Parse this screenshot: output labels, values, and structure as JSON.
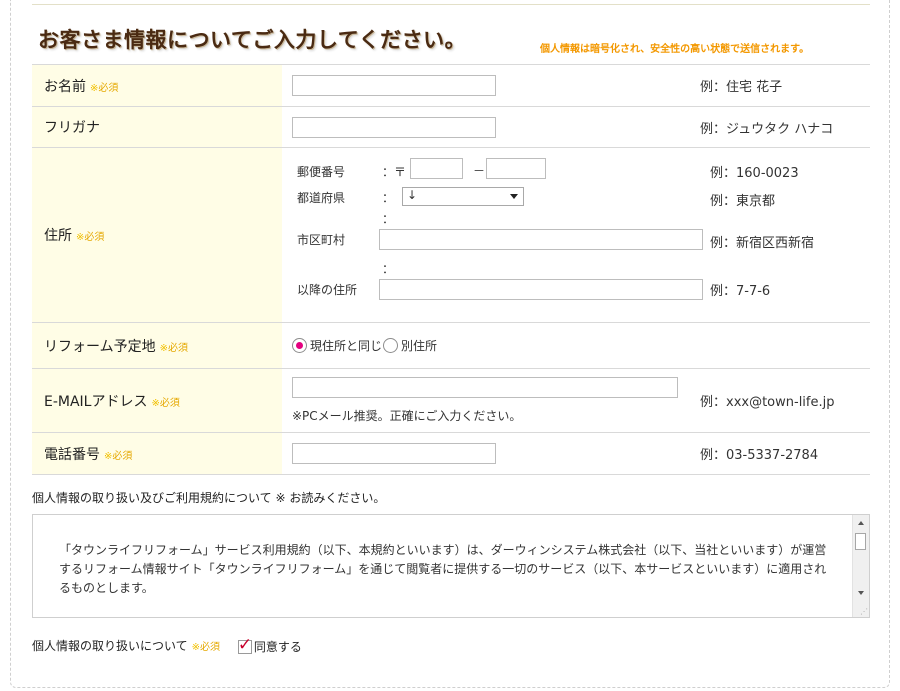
{
  "header": {
    "title": "お客さま情報についてご入力してください。",
    "notice": "個人情報は暗号化され、安全性の高い状態で送信されます。"
  },
  "required_mark": "※",
  "required_text": "必須",
  "form": {
    "name": {
      "label": "お名前",
      "value": "",
      "example": "例：住宅 花子"
    },
    "kana": {
      "label": "フリガナ",
      "value": "",
      "example": "例：ジュウタク ハナコ"
    },
    "address": {
      "label": "住所",
      "zip": {
        "label": "郵便番号",
        "prefix": "：〒",
        "dash": "－",
        "example": "例：160-0023"
      },
      "pref": {
        "label": "都道府県",
        "colon": "：",
        "selected": "↓",
        "example": "例：東京都"
      },
      "city": {
        "label": "市区町村",
        "colon": "：",
        "example": "例：新宿区西新宿"
      },
      "rest": {
        "label": "以降の住所",
        "colon": "：",
        "example": "例：7-7-6"
      }
    },
    "reform": {
      "label": "リフォーム予定地",
      "options": [
        "現住所と同じ",
        "別住所"
      ],
      "selected_index": 0
    },
    "email": {
      "label": "E-MAILアドレス",
      "note": "※PCメール推奨。正確にご入力ください。",
      "example": "例：xxx@town-life.jp"
    },
    "tel": {
      "label": "電話番号",
      "example": "例：03-5337-2784"
    }
  },
  "terms": {
    "title": "個人情報の取り扱い及びご利用規約について ※ お読みください。",
    "body": "「タウンライフリフォーム」サービス利用規約（以下、本規約といいます）は、ダーウィンシステム株式会社（以下、当社といいます）が運営するリフォーム情報サイト「タウンライフリフォーム」を通じて閲覧者に提供する一切のサービス（以下、本サービスといいます）に適用されるものとします。"
  },
  "agree": {
    "label": "個人情報の取り扱いについて",
    "checkbox_label": "同意する",
    "checked": true
  },
  "colors": {
    "accent": "#f39800",
    "label_bg": "#fffde6",
    "radio_on": "#e4007f",
    "check": "#c8002c"
  }
}
